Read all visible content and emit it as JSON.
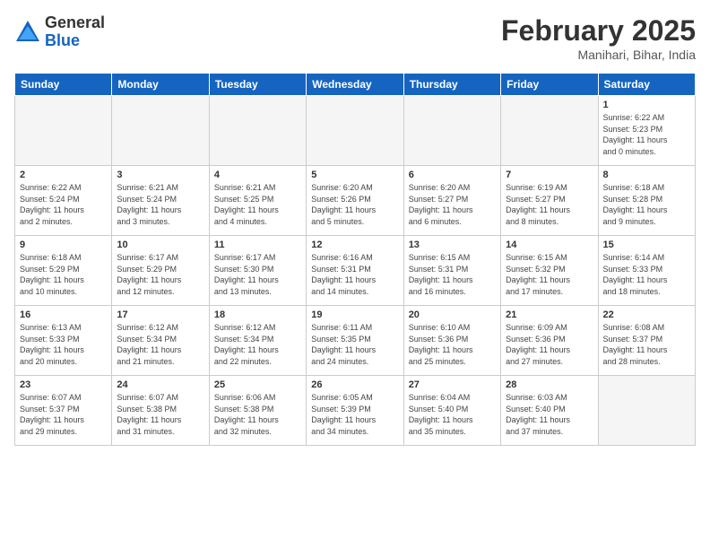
{
  "logo": {
    "general": "General",
    "blue": "Blue"
  },
  "title": "February 2025",
  "location": "Manihari, Bihar, India",
  "days_header": [
    "Sunday",
    "Monday",
    "Tuesday",
    "Wednesday",
    "Thursday",
    "Friday",
    "Saturday"
  ],
  "weeks": [
    [
      {
        "day": "",
        "info": ""
      },
      {
        "day": "",
        "info": ""
      },
      {
        "day": "",
        "info": ""
      },
      {
        "day": "",
        "info": ""
      },
      {
        "day": "",
        "info": ""
      },
      {
        "day": "",
        "info": ""
      },
      {
        "day": "1",
        "info": "Sunrise: 6:22 AM\nSunset: 5:23 PM\nDaylight: 11 hours\nand 0 minutes."
      }
    ],
    [
      {
        "day": "2",
        "info": "Sunrise: 6:22 AM\nSunset: 5:24 PM\nDaylight: 11 hours\nand 2 minutes."
      },
      {
        "day": "3",
        "info": "Sunrise: 6:21 AM\nSunset: 5:24 PM\nDaylight: 11 hours\nand 3 minutes."
      },
      {
        "day": "4",
        "info": "Sunrise: 6:21 AM\nSunset: 5:25 PM\nDaylight: 11 hours\nand 4 minutes."
      },
      {
        "day": "5",
        "info": "Sunrise: 6:20 AM\nSunset: 5:26 PM\nDaylight: 11 hours\nand 5 minutes."
      },
      {
        "day": "6",
        "info": "Sunrise: 6:20 AM\nSunset: 5:27 PM\nDaylight: 11 hours\nand 6 minutes."
      },
      {
        "day": "7",
        "info": "Sunrise: 6:19 AM\nSunset: 5:27 PM\nDaylight: 11 hours\nand 8 minutes."
      },
      {
        "day": "8",
        "info": "Sunrise: 6:18 AM\nSunset: 5:28 PM\nDaylight: 11 hours\nand 9 minutes."
      }
    ],
    [
      {
        "day": "9",
        "info": "Sunrise: 6:18 AM\nSunset: 5:29 PM\nDaylight: 11 hours\nand 10 minutes."
      },
      {
        "day": "10",
        "info": "Sunrise: 6:17 AM\nSunset: 5:29 PM\nDaylight: 11 hours\nand 12 minutes."
      },
      {
        "day": "11",
        "info": "Sunrise: 6:17 AM\nSunset: 5:30 PM\nDaylight: 11 hours\nand 13 minutes."
      },
      {
        "day": "12",
        "info": "Sunrise: 6:16 AM\nSunset: 5:31 PM\nDaylight: 11 hours\nand 14 minutes."
      },
      {
        "day": "13",
        "info": "Sunrise: 6:15 AM\nSunset: 5:31 PM\nDaylight: 11 hours\nand 16 minutes."
      },
      {
        "day": "14",
        "info": "Sunrise: 6:15 AM\nSunset: 5:32 PM\nDaylight: 11 hours\nand 17 minutes."
      },
      {
        "day": "15",
        "info": "Sunrise: 6:14 AM\nSunset: 5:33 PM\nDaylight: 11 hours\nand 18 minutes."
      }
    ],
    [
      {
        "day": "16",
        "info": "Sunrise: 6:13 AM\nSunset: 5:33 PM\nDaylight: 11 hours\nand 20 minutes."
      },
      {
        "day": "17",
        "info": "Sunrise: 6:12 AM\nSunset: 5:34 PM\nDaylight: 11 hours\nand 21 minutes."
      },
      {
        "day": "18",
        "info": "Sunrise: 6:12 AM\nSunset: 5:34 PM\nDaylight: 11 hours\nand 22 minutes."
      },
      {
        "day": "19",
        "info": "Sunrise: 6:11 AM\nSunset: 5:35 PM\nDaylight: 11 hours\nand 24 minutes."
      },
      {
        "day": "20",
        "info": "Sunrise: 6:10 AM\nSunset: 5:36 PM\nDaylight: 11 hours\nand 25 minutes."
      },
      {
        "day": "21",
        "info": "Sunrise: 6:09 AM\nSunset: 5:36 PM\nDaylight: 11 hours\nand 27 minutes."
      },
      {
        "day": "22",
        "info": "Sunrise: 6:08 AM\nSunset: 5:37 PM\nDaylight: 11 hours\nand 28 minutes."
      }
    ],
    [
      {
        "day": "23",
        "info": "Sunrise: 6:07 AM\nSunset: 5:37 PM\nDaylight: 11 hours\nand 29 minutes."
      },
      {
        "day": "24",
        "info": "Sunrise: 6:07 AM\nSunset: 5:38 PM\nDaylight: 11 hours\nand 31 minutes."
      },
      {
        "day": "25",
        "info": "Sunrise: 6:06 AM\nSunset: 5:38 PM\nDaylight: 11 hours\nand 32 minutes."
      },
      {
        "day": "26",
        "info": "Sunrise: 6:05 AM\nSunset: 5:39 PM\nDaylight: 11 hours\nand 34 minutes."
      },
      {
        "day": "27",
        "info": "Sunrise: 6:04 AM\nSunset: 5:40 PM\nDaylight: 11 hours\nand 35 minutes."
      },
      {
        "day": "28",
        "info": "Sunrise: 6:03 AM\nSunset: 5:40 PM\nDaylight: 11 hours\nand 37 minutes."
      },
      {
        "day": "",
        "info": ""
      }
    ]
  ]
}
